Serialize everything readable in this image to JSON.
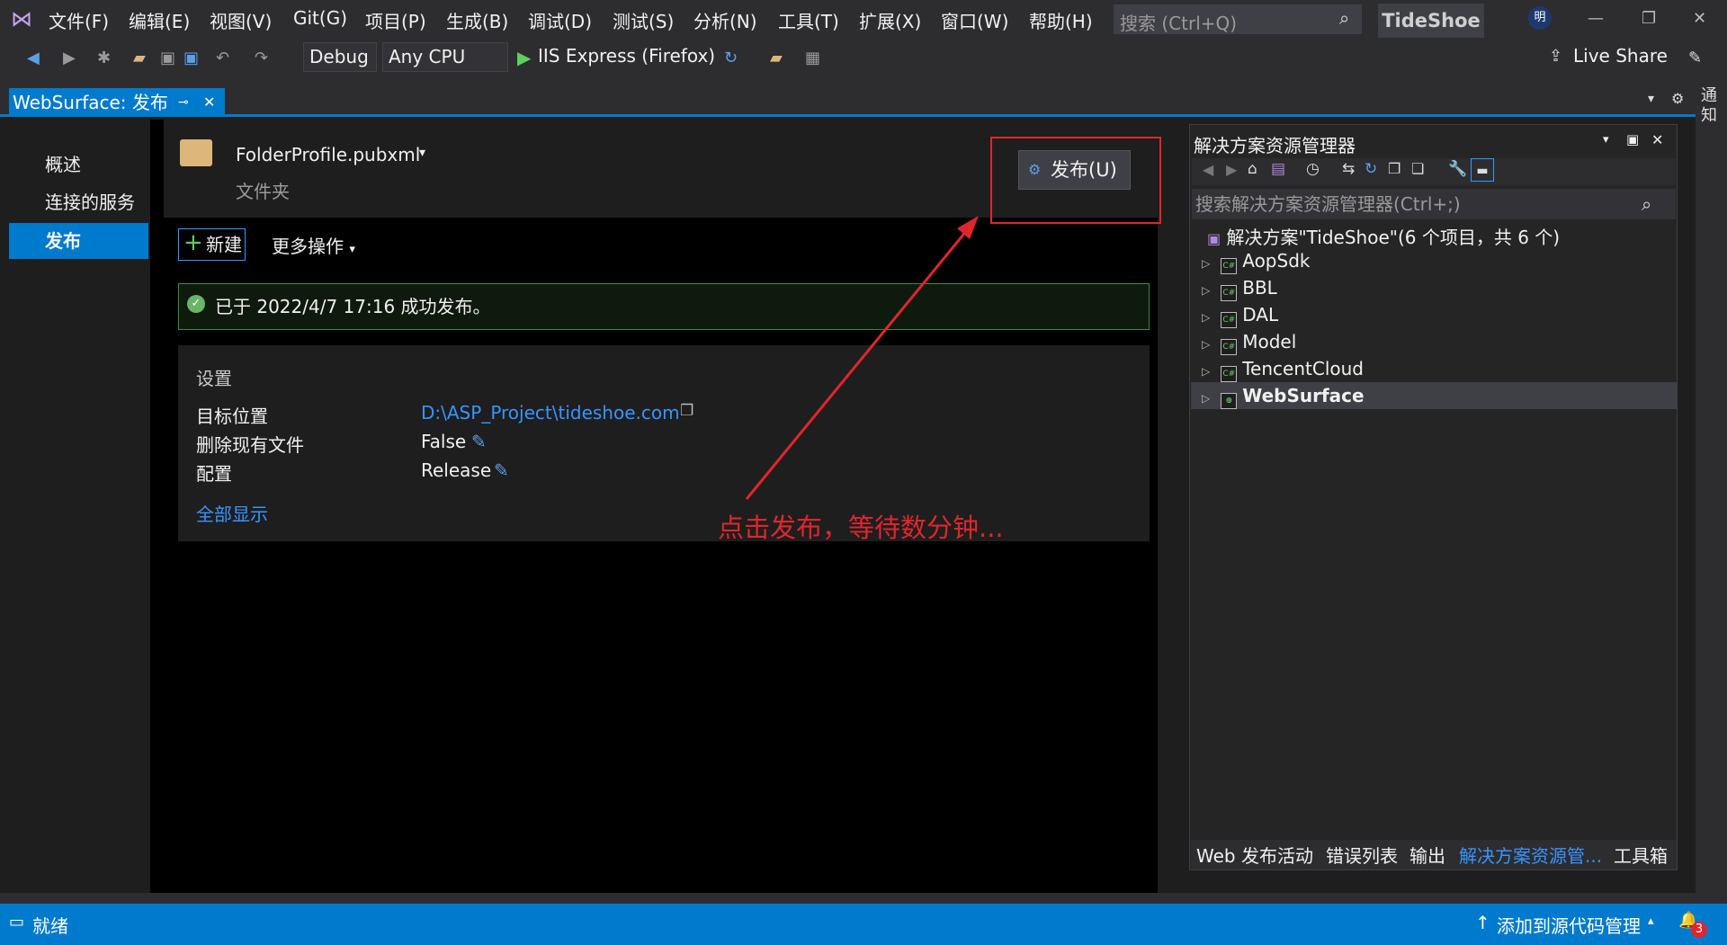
{
  "menu": [
    "文件(F)",
    "编辑(E)",
    "视图(V)",
    "Git(G)",
    "项目(P)",
    "生成(B)",
    "调试(D)",
    "测试(S)",
    "分析(N)",
    "工具(T)",
    "扩展(X)",
    "窗口(W)",
    "帮助(H)"
  ],
  "search": {
    "placeholder": "搜索 (Ctrl+Q)"
  },
  "app_name": "TideShoe",
  "user_initial": "明",
  "toolbar": {
    "config": "Debug",
    "platform": "Any CPU",
    "run_target": "IIS Express (Firefox)",
    "live_share": "Live Share"
  },
  "tab": {
    "title": "WebSurface: 发布"
  },
  "rail_label": "通知",
  "nav": {
    "items": [
      "概述",
      "连接的服务",
      "发布"
    ],
    "active": 2
  },
  "profile": {
    "name": "FolderProfile.pubxml",
    "type": "文件夹"
  },
  "publish_button": "发布(U)",
  "new_button": "新建",
  "more_actions": "更多操作",
  "success_message": "已于 2022/4/7 17:16 成功发布。",
  "settings": {
    "title": "设置",
    "rows": [
      {
        "label": "目标位置",
        "value": "D:\\ASP_Project\\tideshoe.com"
      },
      {
        "label": "删除现有文件",
        "value": "False"
      },
      {
        "label": "配置",
        "value": "Release"
      }
    ],
    "show_all": "全部显示"
  },
  "annotation": "点击发布，等待数分钟...",
  "solution_explorer": {
    "title": "解决方案资源管理器",
    "search_placeholder": "搜索解决方案资源管理器(Ctrl+;)",
    "solution": "解决方案\"TideShoe\"(6 个项目，共 6 个)",
    "projects": [
      "AopSdk",
      "BBL",
      "DAL",
      "Model",
      "TencentCloud",
      "WebSurface"
    ],
    "selected": "WebSurface",
    "bottom_tabs": [
      "Web 发布活动",
      "错误列表",
      "输出",
      "解决方案资源管...",
      "工具箱"
    ]
  },
  "status": {
    "left": "就绪",
    "right": "添加到源代码管理",
    "badge": "3"
  },
  "colors": {
    "accent": "#007acc",
    "annotation": "#e0262c",
    "link": "#3794ff"
  }
}
